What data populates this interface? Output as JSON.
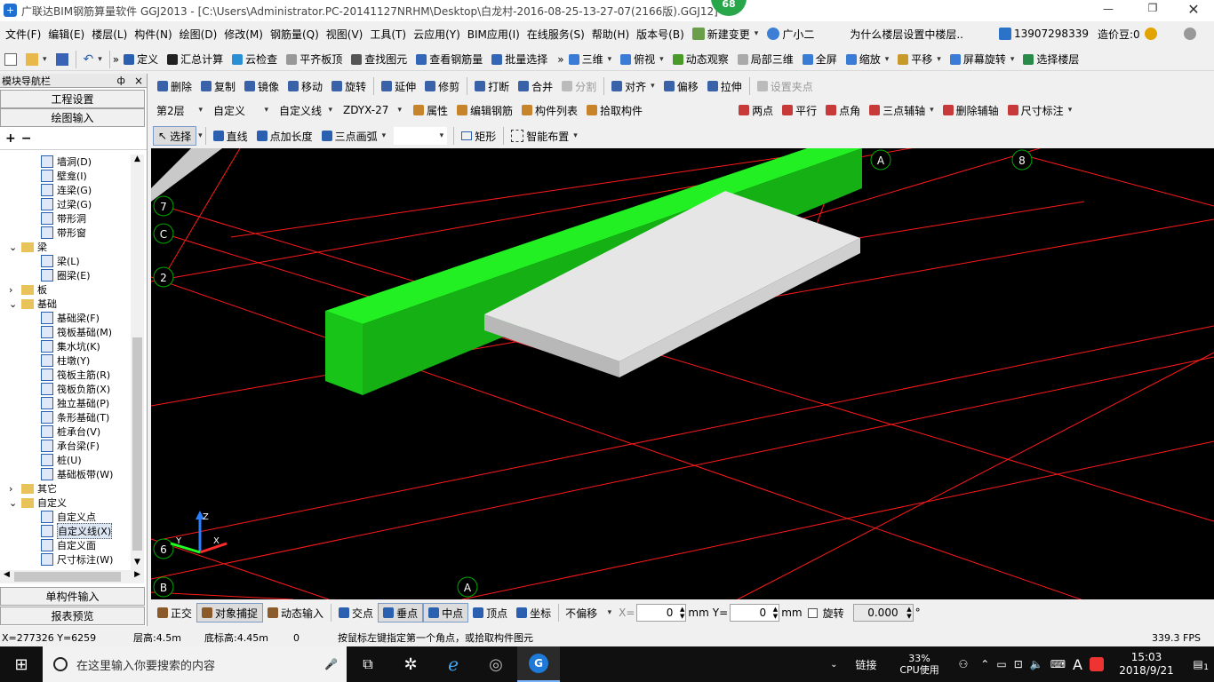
{
  "window": {
    "title": "广联达BIM钢筋算量软件 GGJ2013 - [C:\\Users\\Administrator.PC-20141127NRHM\\Desktop\\白龙村-2016-08-25-13-27-07(2166版).GGJ12]",
    "badge": "68"
  },
  "menu": {
    "items": [
      "文件(F)",
      "编辑(E)",
      "楼层(L)",
      "构件(N)",
      "绘图(D)",
      "修改(M)",
      "钢筋量(Q)",
      "视图(V)",
      "工具(T)",
      "云应用(Y)",
      "BIM应用(I)",
      "在线服务(S)",
      "帮助(H)",
      "版本号(B)"
    ],
    "new_change": "新建变更",
    "assistant": "广小二",
    "question": "为什么楼层设置中楼层..",
    "phone": "13907298339",
    "beans": "造价豆:0"
  },
  "toolbar1": {
    "items": [
      "定义",
      "汇总计算",
      "云检查",
      "平齐板顶",
      "查找图元",
      "查看钢筋量",
      "批量选择"
    ],
    "right": [
      "三维",
      "俯视",
      "动态观察",
      "局部三维",
      "全屏",
      "缩放",
      "平移",
      "屏幕旋转",
      "选择楼层"
    ]
  },
  "toolbar2": {
    "items": [
      "删除",
      "复制",
      "镜像",
      "移动",
      "旋转",
      "延伸",
      "修剪",
      "打断",
      "合并",
      "分割",
      "对齐",
      "偏移",
      "拉伸",
      "设置夹点"
    ]
  },
  "toolbar3": {
    "floor": "第2层",
    "category": "自定义",
    "type": "自定义线",
    "name": "ZDYX-27",
    "items": [
      "属性",
      "编辑钢筋",
      "构件列表",
      "拾取构件"
    ],
    "aux": [
      "两点",
      "平行",
      "点角",
      "三点辅轴",
      "删除辅轴",
      "尺寸标注"
    ]
  },
  "toolbar4": {
    "select": "选择",
    "items": [
      "直线",
      "点加长度",
      "三点画弧"
    ],
    "shape": "矩形",
    "smart": "智能布置"
  },
  "nav": {
    "title": "模块导航栏",
    "pin": "ф",
    "close": "×",
    "engineering": "工程设置",
    "drawing": "绘图输入",
    "single": "单构件输入",
    "report": "报表预览",
    "tree": [
      {
        "label": "墙洞(D)",
        "level": 2
      },
      {
        "label": "壁龛(I)",
        "level": 2
      },
      {
        "label": "连梁(G)",
        "level": 2
      },
      {
        "label": "过梁(G)",
        "level": 2
      },
      {
        "label": "带形洞",
        "level": 2
      },
      {
        "label": "带形窗",
        "level": 2
      },
      {
        "label": "梁",
        "level": 1,
        "expanded": true
      },
      {
        "label": "梁(L)",
        "level": 2
      },
      {
        "label": "圈梁(E)",
        "level": 2
      },
      {
        "label": "板",
        "level": 1,
        "expanded": false
      },
      {
        "label": "基础",
        "level": 1,
        "expanded": true
      },
      {
        "label": "基础梁(F)",
        "level": 2
      },
      {
        "label": "筏板基础(M)",
        "level": 2
      },
      {
        "label": "集水坑(K)",
        "level": 2
      },
      {
        "label": "柱墩(Y)",
        "level": 2
      },
      {
        "label": "筏板主筋(R)",
        "level": 2
      },
      {
        "label": "筏板负筋(X)",
        "level": 2
      },
      {
        "label": "独立基础(P)",
        "level": 2
      },
      {
        "label": "条形基础(T)",
        "level": 2
      },
      {
        "label": "桩承台(V)",
        "level": 2
      },
      {
        "label": "承台梁(F)",
        "level": 2
      },
      {
        "label": "桩(U)",
        "level": 2
      },
      {
        "label": "基础板带(W)",
        "level": 2
      },
      {
        "label": "其它",
        "level": 1,
        "expanded": false
      },
      {
        "label": "自定义",
        "level": 1,
        "expanded": true
      },
      {
        "label": "自定义点",
        "level": 2
      },
      {
        "label": "自定义线(X)",
        "level": 2,
        "selected": true
      },
      {
        "label": "自定义面",
        "level": 2
      },
      {
        "label": "尺寸标注(W)",
        "level": 2
      }
    ]
  },
  "viewport": {
    "axis_labels": [
      "A",
      "8",
      "7",
      "C",
      "2",
      "6",
      "B",
      "A"
    ],
    "colors": {
      "background": "#000000",
      "grid": "#ff0000",
      "beam": "#00dd00",
      "slab": "#e8e8e8"
    }
  },
  "snapbar": {
    "items": [
      "正交",
      "对象捕捉",
      "动态输入",
      "交点",
      "垂点",
      "中点",
      "顶点",
      "坐标"
    ],
    "offset": "不偏移",
    "x_label": "X=",
    "x_value": "0",
    "y_label": "Y=",
    "y_value": "0",
    "unit": "mm",
    "rotate_label": "旋转",
    "rotate_value": "0.000",
    "degree": "°"
  },
  "status": {
    "coords": "X=277326 Y=6259",
    "floor_height": "层高:4.5m",
    "base_height": "底标高:4.45m",
    "zero": "0",
    "hint": "按鼠标左键指定第一个角点，或拾取构件图元",
    "fps": "339.3 FPS"
  },
  "taskbar": {
    "search": "在这里输入你要搜索的内容",
    "link": "链接",
    "cpu_percent": "33%",
    "cpu_label": "CPU使用",
    "ime": "A",
    "time": "15:03",
    "date": "2018/9/21",
    "notif": "1"
  }
}
